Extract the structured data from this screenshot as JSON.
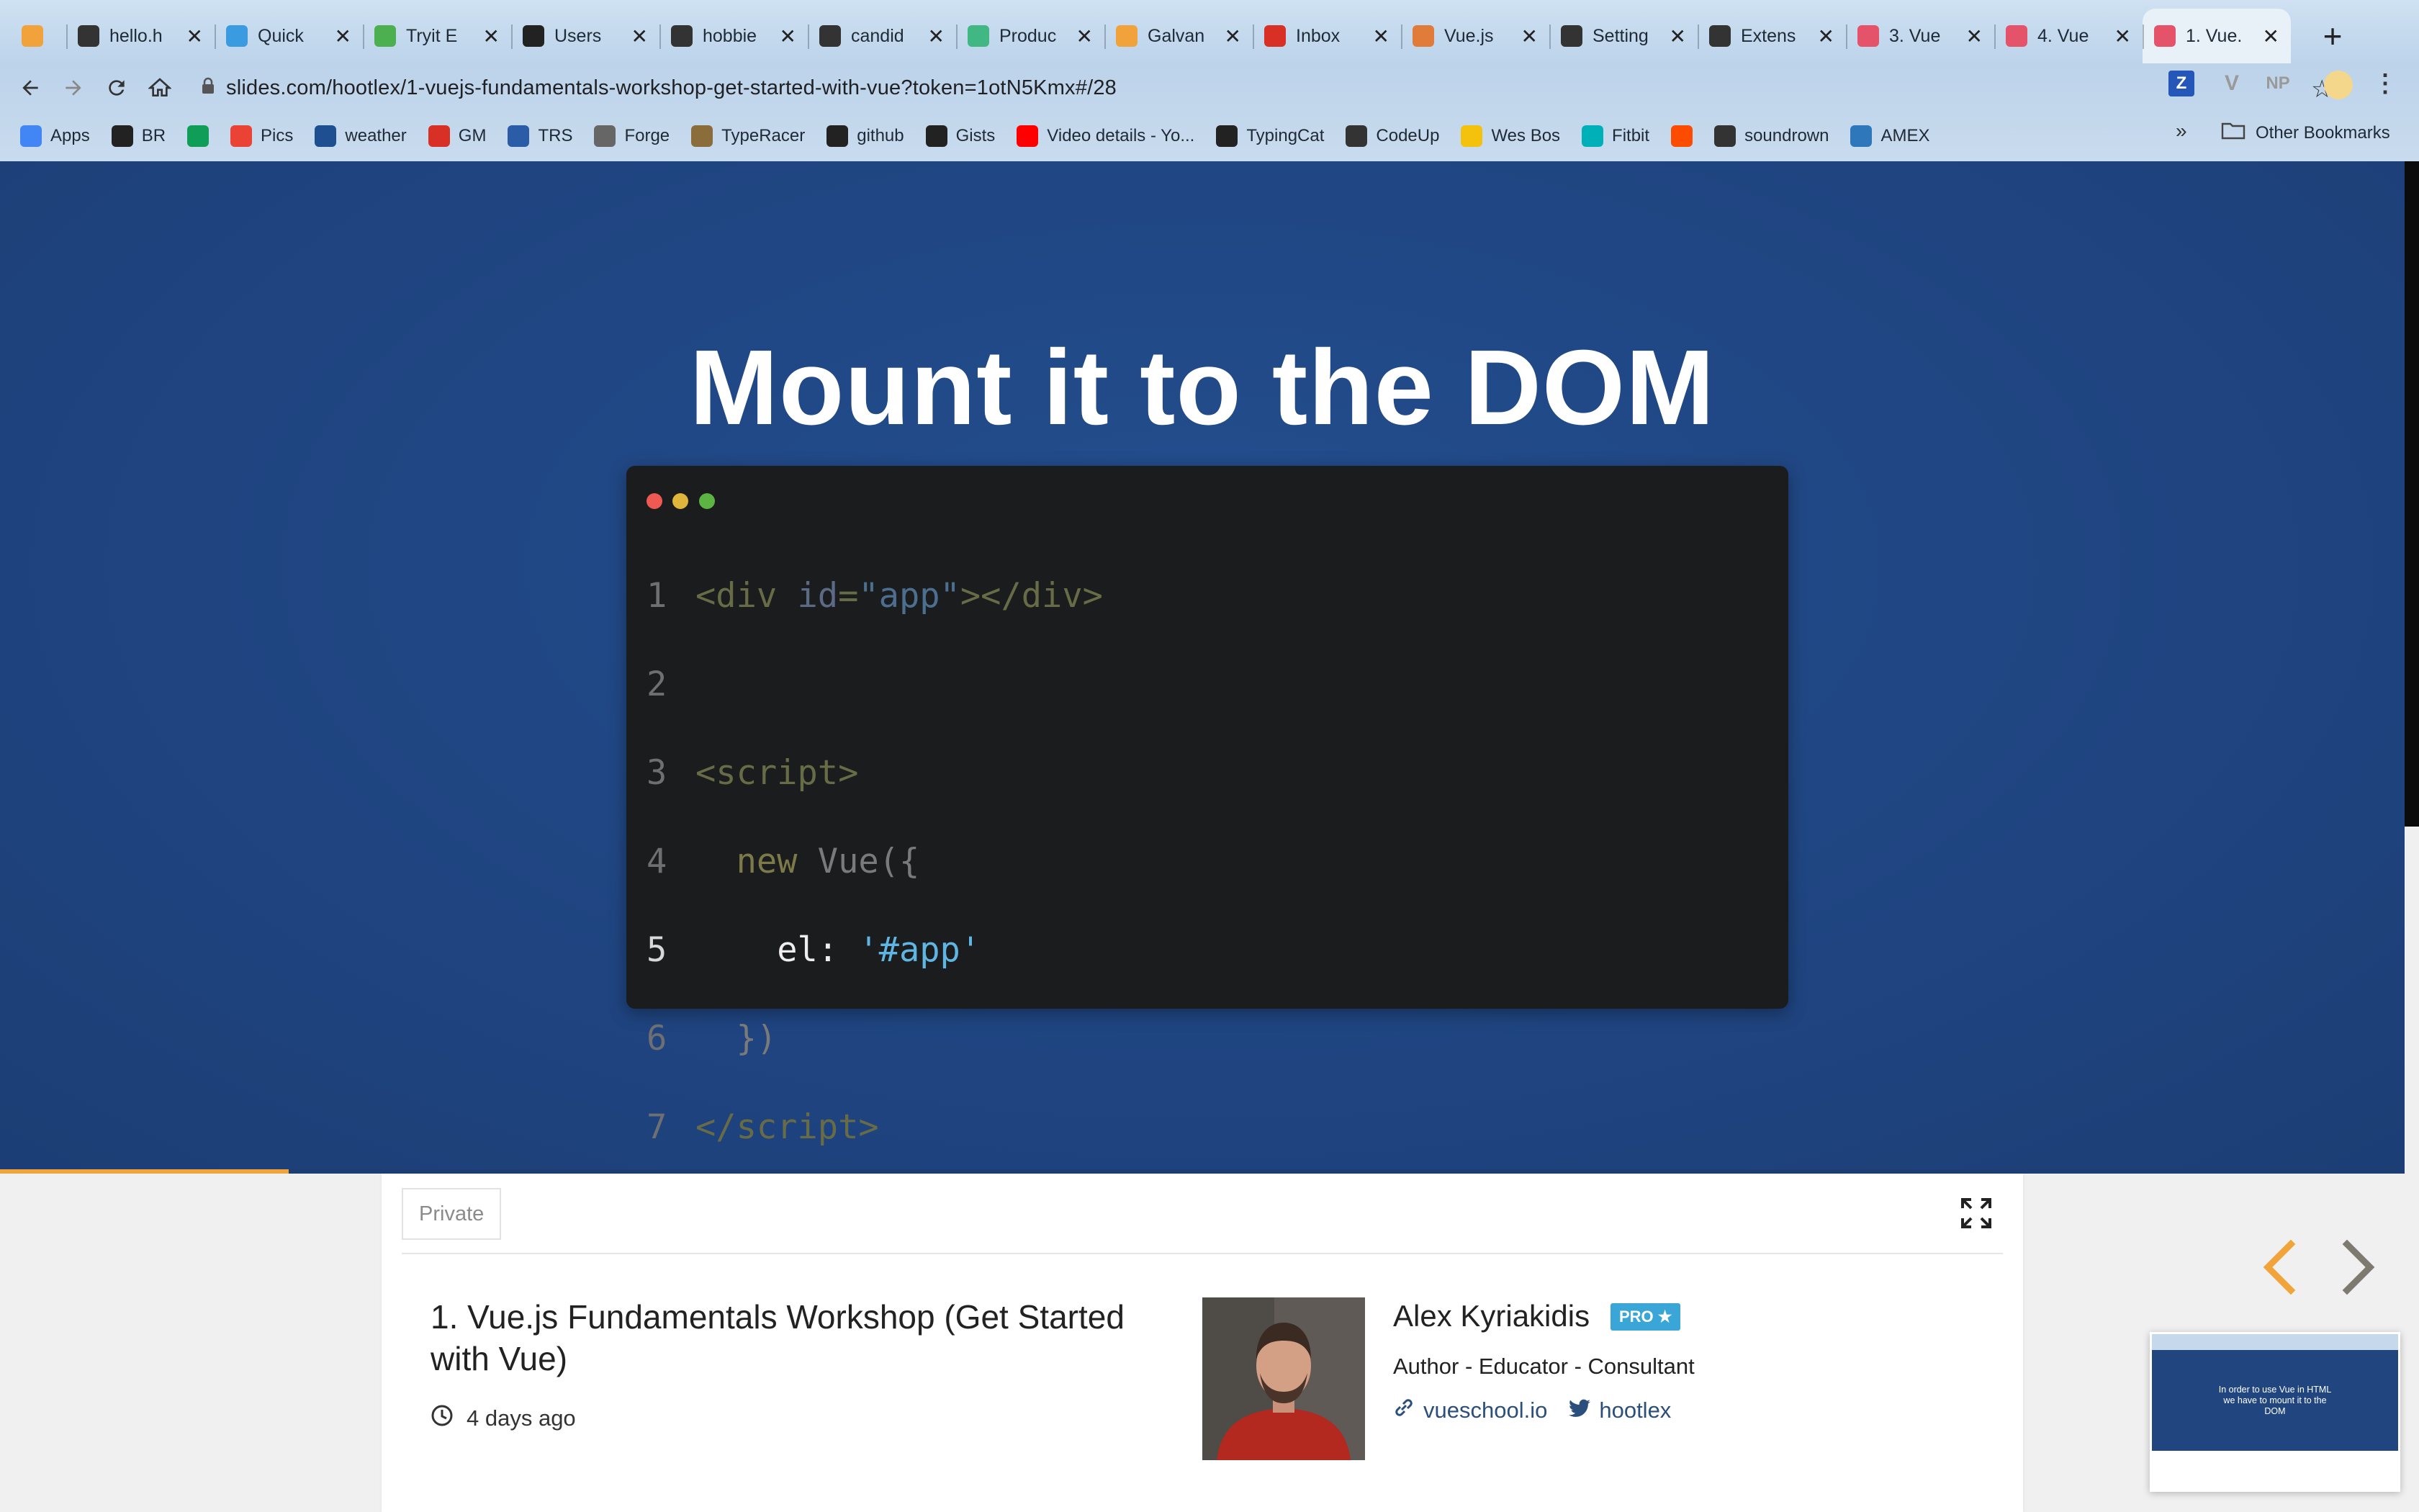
{
  "browser": {
    "tabs": [
      {
        "title": "",
        "icon": "galvanize-icon",
        "color": "#f2a23b"
      },
      {
        "title": "hello.h",
        "icon": "globe-icon",
        "color": "#333333"
      },
      {
        "title": "Quick",
        "icon": "b-icon",
        "color": "#3a9be0"
      },
      {
        "title": "Tryit E",
        "icon": "w3-icon",
        "color": "#4caf50"
      },
      {
        "title": "Users",
        "icon": "github-icon",
        "color": "#222222"
      },
      {
        "title": "hobbie",
        "icon": "globe-icon",
        "color": "#333333"
      },
      {
        "title": "candid",
        "icon": "globe-icon",
        "color": "#333333"
      },
      {
        "title": "Produc",
        "icon": "vue-icon",
        "color": "#41b883"
      },
      {
        "title": "Galvan",
        "icon": "galvanize-icon",
        "color": "#f2a23b"
      },
      {
        "title": "Inbox",
        "icon": "gmail-icon",
        "color": "#d93025"
      },
      {
        "title": "Vue.js",
        "icon": "vue-icon",
        "color": "#e07b39"
      },
      {
        "title": "Setting",
        "icon": "gear-icon",
        "color": "#333333"
      },
      {
        "title": "Extens",
        "icon": "puzzle-icon",
        "color": "#333333"
      },
      {
        "title": "3. Vue",
        "icon": "slides-icon",
        "color": "#e4536a"
      },
      {
        "title": "4. Vue",
        "icon": "slides-icon",
        "color": "#e4536a"
      },
      {
        "title": "1. Vue.",
        "icon": "slides-icon",
        "color": "#e4536a",
        "active": true
      }
    ],
    "url": "slides.com/hootlex/1-vuejs-fundamentals-workshop-get-started-with-vue?token=1otN5Kmx#/28",
    "bookmarks": [
      {
        "label": "Apps",
        "icon": "apps-icon",
        "color": "#4285f4"
      },
      {
        "label": "BR",
        "icon": "github-icon",
        "color": "#222222"
      },
      {
        "label": "",
        "icon": "drive-icon",
        "color": "#0f9d58"
      },
      {
        "label": "Pics",
        "icon": "photos-icon",
        "color": "#ea4335"
      },
      {
        "label": "weather",
        "icon": "weather-icon",
        "color": "#1d4f91"
      },
      {
        "label": "GM",
        "icon": "gmail-icon",
        "color": "#d93025"
      },
      {
        "label": "TRS",
        "icon": "uc-icon",
        "color": "#2a5ca8"
      },
      {
        "label": "Forge",
        "icon": "forge-icon",
        "color": "#666666"
      },
      {
        "label": "TypeRacer",
        "icon": "typeracer-icon",
        "color": "#8a6d3b"
      },
      {
        "label": "github",
        "icon": "github-icon",
        "color": "#222222"
      },
      {
        "label": "Gists",
        "icon": "github-icon",
        "color": "#222222"
      },
      {
        "label": "Video details - Yo...",
        "icon": "youtube-icon",
        "color": "#ff0000"
      },
      {
        "label": "TypingCat",
        "icon": "paw-icon",
        "color": "#222222"
      },
      {
        "label": "CodeUp",
        "icon": "globe-icon",
        "color": "#333333"
      },
      {
        "label": "Wes Bos",
        "icon": "crown-icon",
        "color": "#f4c20d"
      },
      {
        "label": "Fitbit",
        "icon": "fitbit-icon",
        "color": "#00b0b9"
      },
      {
        "label": "",
        "icon": "strava-icon",
        "color": "#fc4c02"
      },
      {
        "label": "soundrown",
        "icon": "globe-icon",
        "color": "#333333"
      },
      {
        "label": "AMEX",
        "icon": "amex-icon",
        "color": "#2e77bb"
      }
    ],
    "bookmarks_more": "»",
    "other_bookmarks": "Other Bookmarks",
    "extensions": {
      "z": "Z",
      "np": "NP"
    }
  },
  "slide": {
    "title": "Mount it to the DOM",
    "code_lines": [
      "1",
      "2",
      "3",
      "4",
      "5",
      "6",
      "7"
    ],
    "progress": 0.12
  },
  "deck": {
    "visibility": "Private",
    "title": "1. Vue.js Fundamentals Workshop (Get Started with Vue)",
    "time": "4 days ago"
  },
  "author": {
    "name": "Alex Kyriakidis",
    "badge": "PRO",
    "role": "Author - Educator - Consultant",
    "website": "vueschool.io",
    "twitter": "hootlex"
  },
  "thumbnail": {
    "text": "In order to use Vue in HTML we have to mount it to the DOM"
  },
  "colors": {
    "slide_bg": "#21467f",
    "accent": "#f0a43a",
    "pro_badge": "#3aa6d8"
  }
}
